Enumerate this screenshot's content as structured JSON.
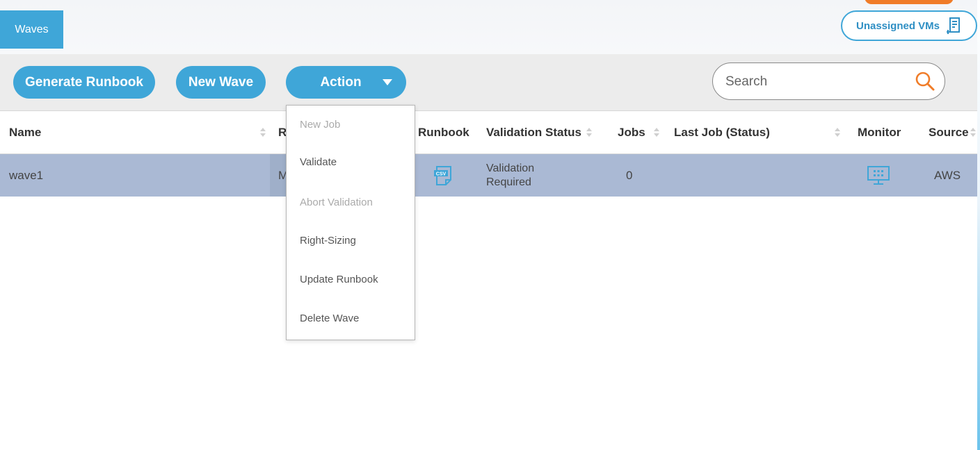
{
  "header": {
    "tab_label": "Waves",
    "unassigned_vms_label": "Unassigned VMs"
  },
  "toolbar": {
    "generate_runbook_label": "Generate Runbook",
    "new_wave_label": "New Wave",
    "action_label": "Action",
    "search_placeholder": "Search"
  },
  "action_menu": {
    "items": [
      {
        "label": "New Job",
        "enabled": false
      },
      {
        "label": "Validate",
        "enabled": true
      },
      {
        "label": "Abort Validation",
        "enabled": false
      },
      {
        "label": "Right-Sizing",
        "enabled": true
      },
      {
        "label": "Update Runbook",
        "enabled": true
      },
      {
        "label": "Delete Wave",
        "enabled": true
      }
    ]
  },
  "table": {
    "columns": [
      "Name",
      "R",
      "Runbook",
      "Validation Status",
      "Jobs",
      "Last Job (Status)",
      "Monitor",
      "Source"
    ],
    "rows": [
      {
        "name": "wave1",
        "r": "M",
        "runbook_icon": "csv-file-icon",
        "validation_status_line1": "Validation",
        "validation_status_line2": "Required",
        "jobs": "0",
        "last_job": "",
        "monitor_icon": "monitor-icon",
        "source": "AWS"
      }
    ]
  },
  "colors": {
    "accent_blue": "#3fa6d8",
    "selected_row": "#aab9d4",
    "orange": "#f07c28",
    "toolbar_bg": "#ececec"
  }
}
